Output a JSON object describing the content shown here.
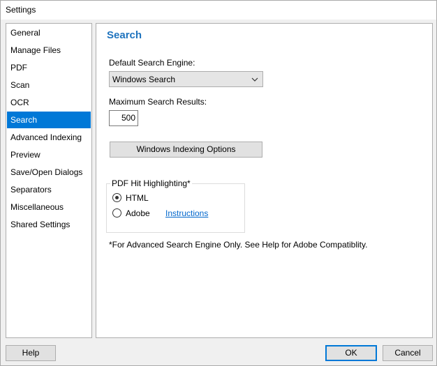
{
  "window": {
    "title": "Settings"
  },
  "sidebar": {
    "items": [
      {
        "label": "General"
      },
      {
        "label": "Manage Files"
      },
      {
        "label": "PDF"
      },
      {
        "label": "Scan"
      },
      {
        "label": "OCR"
      },
      {
        "label": "Search",
        "selected": true
      },
      {
        "label": "Advanced Indexing"
      },
      {
        "label": "Preview"
      },
      {
        "label": "Save/Open Dialogs"
      },
      {
        "label": "Separators"
      },
      {
        "label": "Miscellaneous"
      },
      {
        "label": "Shared Settings"
      }
    ]
  },
  "search_panel": {
    "title": "Search",
    "engine_label": "Default Search Engine:",
    "engine_value": "Windows Search",
    "max_results_label": "Maximum Search Results:",
    "max_results_value": "500",
    "indexing_button": "Windows Indexing Options",
    "highlight_group": {
      "legend": "PDF Hit Highlighting*",
      "options": [
        {
          "label": "HTML",
          "checked": true
        },
        {
          "label": "Adobe",
          "checked": false
        }
      ],
      "instructions_link": "Instructions"
    },
    "footnote": "*For Advanced Search Engine Only. See Help for Adobe Compatiblity."
  },
  "footer": {
    "help": "Help",
    "ok": "OK",
    "cancel": "Cancel"
  },
  "colors": {
    "accent": "#0078d7",
    "section_title": "#1e73be",
    "link": "#0066cc"
  }
}
